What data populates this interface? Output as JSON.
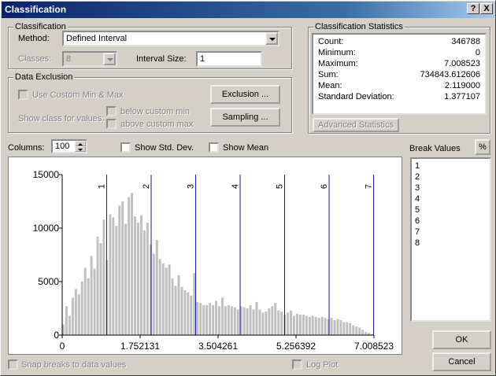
{
  "window": {
    "title": "Classification",
    "help_label": "?",
    "close_label": "X"
  },
  "classification": {
    "group_title": "Classification",
    "method_label": "Method:",
    "method_value": "Defined Interval",
    "classes_label": "Classes:",
    "classes_value": "8",
    "interval_label": "Interval Size:",
    "interval_value": "1"
  },
  "exclusion": {
    "group_title": "Data Exclusion",
    "use_custom_label": "Use Custom Min & Max",
    "show_class_label": "Show class for values:",
    "below_label": "below custom min",
    "above_label": "above custom max",
    "exclusion_button": "Exclusion ...",
    "sampling_button": "Sampling ..."
  },
  "statistics": {
    "group_title": "Classification Statistics",
    "rows": [
      {
        "k": "Count:",
        "v": "346788"
      },
      {
        "k": "Minimum:",
        "v": "0"
      },
      {
        "k": "Maximum:",
        "v": "7.008523"
      },
      {
        "k": "Sum:",
        "v": "734843.612606"
      },
      {
        "k": "Mean:",
        "v": "2.119000"
      },
      {
        "k": "Standard Deviation:",
        "v": "1.377107"
      }
    ],
    "advanced_button": "Advanced Statistics"
  },
  "histogram_controls": {
    "columns_label": "Columns:",
    "columns_value": "100",
    "show_std_label": "Show Std. Dev.",
    "show_mean_label": "Show Mean"
  },
  "break_values": {
    "title": "Break Values",
    "percent_button": "%",
    "items": [
      "1",
      "2",
      "3",
      "4",
      "5",
      "6",
      "7",
      "8"
    ]
  },
  "bottom": {
    "snap_label": "Snap breaks to data values",
    "log_plot_label": "Log Plot",
    "ok_label": "OK",
    "cancel_label": "Cancel"
  },
  "colors": {
    "bar": "#c0c0c0",
    "break_line": "#1a1aa6",
    "axis": "#000000"
  },
  "chart_data": {
    "type": "bar",
    "title": "",
    "xlabel": "",
    "ylabel": "",
    "xlim": [
      0,
      7.008523
    ],
    "ylim": [
      0,
      15000
    ],
    "y_ticks": [
      0,
      5000,
      10000,
      15000
    ],
    "x_tick_labels": [
      "0",
      "1.752131",
      "3.504261",
      "5.256392",
      "7.008523"
    ],
    "break_values": [
      1,
      2,
      3,
      4,
      5,
      6,
      7
    ],
    "break_labels": [
      "1",
      "2",
      "3",
      "4",
      "5",
      "6",
      "7"
    ],
    "series": [
      {
        "values": [
          1000,
          2700,
          1800,
          3500,
          4300,
          3800,
          5000,
          6300,
          5300,
          7400,
          6200,
          9200,
          8600,
          10800,
          7000,
          11300,
          11000,
          10200,
          12100,
          12500,
          10400,
          12900,
          13300,
          11100,
          10500,
          11200,
          9800,
          10500,
          8500,
          7600,
          8900,
          7100,
          6700,
          6300,
          6600,
          5300,
          4600,
          5600,
          4500,
          4200,
          4000,
          3700,
          5800,
          3100,
          3000,
          2800,
          2800,
          3000,
          2800,
          3200,
          2700,
          3500,
          2700,
          2800,
          2700,
          2600,
          2400,
          2700,
          2600,
          2500,
          2800,
          2400,
          3100,
          2400,
          2100,
          2200,
          2500,
          2700,
          3000,
          2300,
          2200,
          1900,
          2100,
          2300,
          1800,
          2000,
          1900,
          1900,
          1800,
          1700,
          1800,
          1700,
          1600,
          1700,
          1600,
          1500,
          1600,
          1400,
          1500,
          1400,
          1200,
          1200,
          1100,
          900,
          800,
          700,
          500,
          300,
          200,
          100
        ]
      }
    ]
  }
}
